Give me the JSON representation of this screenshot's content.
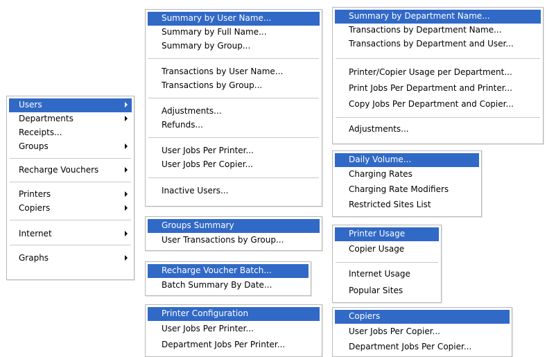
{
  "main_menu": {
    "items": [
      {
        "label": "Users",
        "has_submenu": true,
        "selected": true
      },
      {
        "label": "Departments",
        "has_submenu": true
      },
      {
        "label": "Receipts...",
        "has_submenu": false
      },
      {
        "label": "Groups",
        "has_submenu": true
      },
      {
        "label": "Recharge Vouchers",
        "has_submenu": true
      },
      {
        "label": "Printers",
        "has_submenu": true
      },
      {
        "label": "Copiers",
        "has_submenu": true
      },
      {
        "label": "Internet",
        "has_submenu": true
      },
      {
        "label": "Graphs",
        "has_submenu": true
      }
    ]
  },
  "users_menu": {
    "items": [
      {
        "label": "Summary by User Name...",
        "selected": true
      },
      {
        "label": "Summary by Full Name..."
      },
      {
        "label": "Summary by Group..."
      },
      {
        "label": "Transactions by User Name..."
      },
      {
        "label": "Transactions by Group..."
      },
      {
        "label": "Adjustments..."
      },
      {
        "label": "Refunds..."
      },
      {
        "label": "User Jobs Per Printer..."
      },
      {
        "label": "User Jobs Per Copier..."
      },
      {
        "label": "Inactive Users..."
      }
    ]
  },
  "department_menu": {
    "items": [
      {
        "label": "Summary by Department Name...",
        "selected": true
      },
      {
        "label": "Transactions by Department Name..."
      },
      {
        "label": "Transactions by Department and User..."
      },
      {
        "label": "Printer/Copier Usage per Department..."
      },
      {
        "label": "Print Jobs Per Department and Printer..."
      },
      {
        "label": "Copy Jobs Per Department and Copier..."
      },
      {
        "label": "Adjustments..."
      }
    ]
  },
  "receipts_menu": {
    "items": [
      {
        "label": "Daily Volume...",
        "selected": true
      },
      {
        "label": "Charging Rates"
      },
      {
        "label": "Charging Rate Modifiers"
      },
      {
        "label": "Restricted Sites List"
      }
    ]
  },
  "groups_menu": {
    "items": [
      {
        "label": "Groups Summary",
        "selected": true
      },
      {
        "label": "User Transactions by Group..."
      }
    ]
  },
  "usage_menu": {
    "items": [
      {
        "label": "Printer Usage",
        "selected": true
      },
      {
        "label": "Copier Usage"
      },
      {
        "label": "Internet Usage"
      },
      {
        "label": "Popular Sites"
      }
    ]
  },
  "vouchers_menu": {
    "items": [
      {
        "label": "Recharge Voucher Batch...",
        "selected": true
      },
      {
        "label": "Batch Summary By Date..."
      }
    ]
  },
  "printer_config_menu": {
    "items": [
      {
        "label": "Printer Configuration",
        "selected": true
      },
      {
        "label": "User Jobs Per Printer..."
      },
      {
        "label": "Department Jobs Per Printer..."
      }
    ]
  },
  "copiers_menu": {
    "items": [
      {
        "label": "Copiers",
        "selected": true
      },
      {
        "label": "User Jobs Per Copier..."
      },
      {
        "label": "Department Jobs Per Copier..."
      }
    ]
  },
  "colors": {
    "selection": "#3169c6",
    "selection_text": "#ffffff",
    "border": "#b7b7b7",
    "separator": "#c8c8c8"
  }
}
